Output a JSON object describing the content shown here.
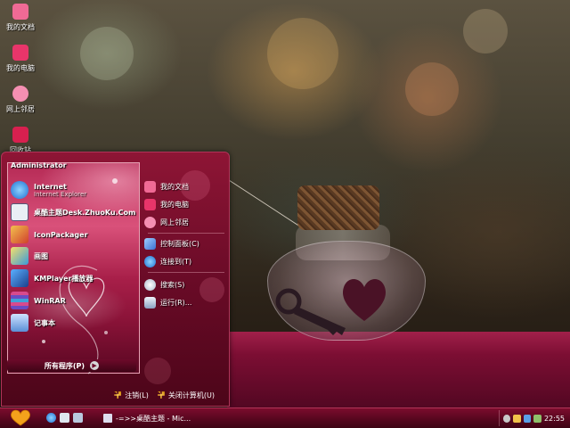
{
  "desktop": {
    "icons": [
      {
        "label": "我的文档",
        "icon": "my-documents-icon",
        "color": "#f06a95"
      },
      {
        "label": "我的电脑",
        "icon": "my-computer-icon",
        "color": "#e8356a"
      },
      {
        "label": "网上邻居",
        "icon": "network-places-icon",
        "color": "#f58fb2"
      },
      {
        "label": "回收站",
        "icon": "recycle-bin-icon",
        "color": "#d8204f"
      }
    ]
  },
  "start_menu": {
    "user_name": "Administrator",
    "programs": [
      {
        "label": "Internet",
        "sublabel": "Internet Explorer",
        "icon": "internet-explorer-icon"
      },
      {
        "label": "桌酷主题Desk.ZhuoKu.Com",
        "sublabel": "",
        "icon": "zhuoku-icon"
      },
      {
        "label": "IconPackager",
        "sublabel": "",
        "icon": "iconpackager-icon"
      },
      {
        "label": "画图",
        "sublabel": "",
        "icon": "paint-icon"
      },
      {
        "label": "KMPlayer播放器",
        "sublabel": "",
        "icon": "kmplayer-icon"
      },
      {
        "label": "WinRAR",
        "sublabel": "",
        "icon": "winrar-icon"
      },
      {
        "label": "记事本",
        "sublabel": "",
        "icon": "notepad-icon"
      }
    ],
    "all_programs_label": "所有程序(P)",
    "places": [
      {
        "label": "我的文档",
        "icon": "my-documents-icon"
      },
      {
        "label": "我的电脑",
        "icon": "my-computer-icon"
      },
      {
        "label": "网上邻居",
        "icon": "network-places-icon"
      },
      {
        "label": "控制面板(C)",
        "icon": "control-panel-icon"
      },
      {
        "label": "连接到(T)",
        "icon": "connect-to-icon"
      },
      {
        "label": "搜索(S)",
        "icon": "search-icon"
      },
      {
        "label": "运行(R)...",
        "icon": "run-icon"
      }
    ],
    "logoff_label": "注销(L)",
    "shutdown_label": "关闭计算机(U)"
  },
  "taskbar": {
    "task_button_label": "-=>>桌酷主题 - Mic...",
    "clock": "22:55"
  },
  "colors": {
    "theme_red": "#8e1535",
    "taskbar_red": "#5a0720",
    "cushion": "#7c0e33"
  }
}
